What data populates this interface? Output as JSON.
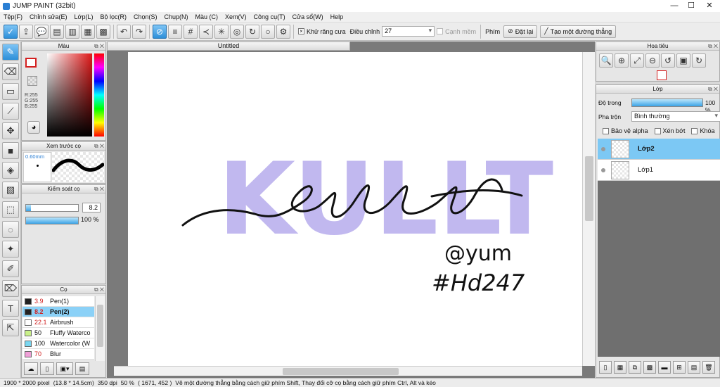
{
  "titlebar": {
    "title": "JUMP PAINT (32bit)",
    "minimize": "—",
    "maximize": "☐",
    "close": "✕"
  },
  "menu": [
    "Tệp(F)",
    "Chỉnh sửa(E)",
    "Lớp(L)",
    "Bộ lọc(R)",
    "Chọn(S)",
    "Chụp(N)",
    "Màu (C)",
    "Xem(V)",
    "Công cụ(T)",
    "Cửa sổ(W)",
    "Help"
  ],
  "toolbar": {
    "antialias_label": "Khử răng cưa",
    "adjust_label": "Điều chỉnh",
    "adjust_value": "27",
    "soft_edge_label": "Cạnh mềm",
    "key_label": "Phím",
    "reset_label": "Đặt lại",
    "straight_line_label": "Tạo một đường thẳng"
  },
  "color_panel": {
    "title": "Màu",
    "r": "R:255",
    "g": "G:255",
    "b": "B:255"
  },
  "brush_preview": {
    "title": "Xem trước cọ",
    "size": "0.60mm"
  },
  "brush_control": {
    "title": "Kiểm soát cọ",
    "size_value": "8.2",
    "opacity_value": "100 %",
    "size_fill": 0.1,
    "opacity_fill": 1.0
  },
  "brushes": {
    "title": "Cọ",
    "items": [
      {
        "size": "3.9",
        "name": "Pen(1)",
        "color": "#222222"
      },
      {
        "size": "8.2",
        "name": "Pen(2)",
        "color": "#222222"
      },
      {
        "size": "22.1",
        "name": "Airbrush",
        "color": "#ffffff"
      },
      {
        "size": "50",
        "name": "Fluffy Waterco",
        "color": "#c9f08a"
      },
      {
        "size": "100",
        "name": "Watercolor (W",
        "color": "#7ad6f0"
      },
      {
        "size": "70",
        "name": "Blur",
        "color": "#f0a0d8"
      }
    ],
    "selected_index": 1
  },
  "document": {
    "tab_title": "Untitled"
  },
  "artwork": {
    "big_text": "KULLT",
    "script_text": "kullt",
    "handle": "@yum",
    "tag": "#Hd247",
    "big_text_color": "#c1b8ef"
  },
  "navigator": {
    "title": "Hoa tiêu"
  },
  "layers": {
    "title": "Lớp",
    "opacity_label": "Độ trong",
    "opacity_value": "100 %",
    "opacity_fill": 1.0,
    "blend_label": "Pha trộn",
    "blend_value": "Bình thường",
    "protect_alpha": "Bảo vệ alpha",
    "clip": "Xén bớt",
    "lock": "Khóa",
    "items": [
      {
        "name": "Lớp2",
        "selected": true
      },
      {
        "name": "Lớp1",
        "selected": false
      }
    ]
  },
  "status": {
    "size": "1900 * 2000 pixel",
    "cm": "(13.8 * 14.5cm)",
    "dpi": "350 dpi",
    "zoom": "50 %",
    "coords": "( 1671, 452 )",
    "hint": "Vẽ một đường thẳng bằng cách giữ phím Shift, Thay đổi cỡ cọ bằng cách giữ phím Ctrl, Alt và kéo"
  }
}
